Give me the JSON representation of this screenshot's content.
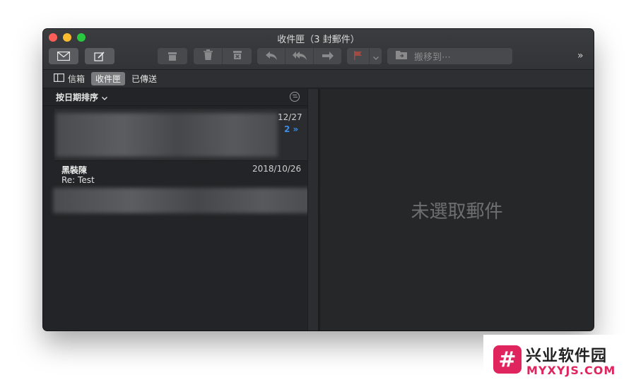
{
  "window": {
    "title": "收件匣（3 封郵件）"
  },
  "toolbar": {
    "move_to_label": "搬移到⋯",
    "overflow_label": "»"
  },
  "favorites": [
    {
      "label": "信箱"
    },
    {
      "label": "收件匣"
    },
    {
      "label": "已傳送"
    }
  ],
  "list": {
    "sort_label": "按日期排序",
    "messages": [
      {
        "date": "12/27",
        "thread_count": "2",
        "thread_glyph": "»"
      },
      {
        "sender": "黑裝陳",
        "date": "2018/10/26",
        "subject": "Re: Test"
      }
    ]
  },
  "viewer": {
    "empty_text": "未選取郵件"
  },
  "watermark": {
    "logo_text": "#",
    "name": "兴业软件园",
    "url": "MYXYJS.COM"
  },
  "colors": {
    "accent": "#3a8ee8",
    "flag": "#e0443a",
    "brand": "#e0245e"
  }
}
